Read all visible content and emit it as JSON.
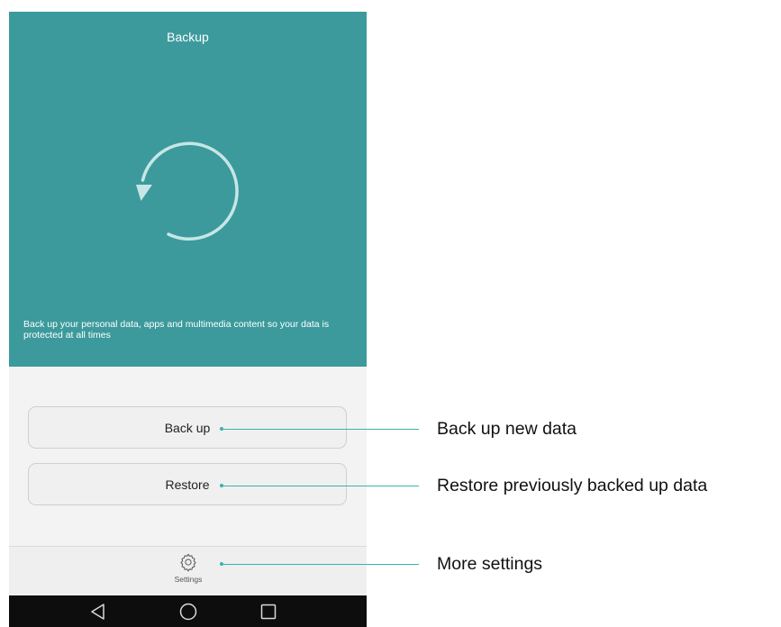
{
  "header": {
    "title": "Backup"
  },
  "hero": {
    "icon": "refresh-circle-icon",
    "description": "Back up your personal data, apps and multimedia content so your data is protected at all times"
  },
  "buttons": {
    "backup_label": "Back up",
    "restore_label": "Restore"
  },
  "bottom_bar": {
    "settings_label": "Settings",
    "settings_icon": "gear-icon"
  },
  "navbar": {
    "back_icon": "back-triangle-icon",
    "home_icon": "home-circle-icon",
    "recent_icon": "recent-square-icon"
  },
  "callouts": {
    "backup": "Back up new data",
    "restore": "Restore previously backed up data",
    "settings": "More settings"
  },
  "colors": {
    "hero_bg": "#3c9a9c",
    "accent_line": "#3ab3b0",
    "navbar_bg": "#0d0d0d"
  }
}
